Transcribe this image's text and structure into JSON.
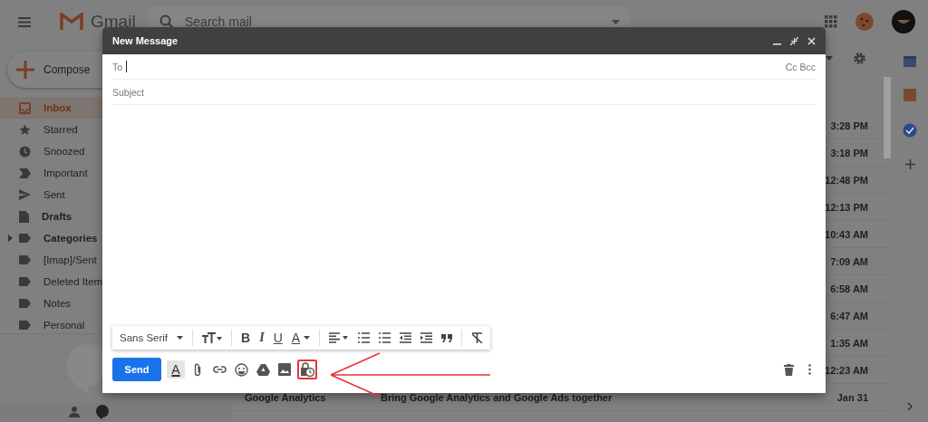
{
  "app": {
    "name": "Gmail",
    "search": {
      "placeholder": "Search mail"
    }
  },
  "compose_button": {
    "label": "Compose"
  },
  "sidebar": {
    "items": [
      {
        "label": "Inbox",
        "selected": true,
        "bold": true
      },
      {
        "label": "Starred",
        "selected": false,
        "bold": false
      },
      {
        "label": "Snoozed",
        "selected": false,
        "bold": false
      },
      {
        "label": "Important",
        "selected": false,
        "bold": false
      },
      {
        "label": "Sent",
        "selected": false,
        "bold": false
      },
      {
        "label": "Drafts",
        "selected": false,
        "bold": true
      },
      {
        "label": "Categories",
        "selected": false,
        "bold": true,
        "expanded": false
      },
      {
        "label": "[Imap]/Sent",
        "selected": false,
        "bold": false
      },
      {
        "label": "Deleted Item",
        "selected": false,
        "bold": false
      },
      {
        "label": "Notes",
        "selected": false,
        "bold": false
      },
      {
        "label": "Personal",
        "selected": false,
        "bold": false
      }
    ]
  },
  "message_list": {
    "rows": [
      {
        "time": "3:28 PM"
      },
      {
        "time": "3:18 PM"
      },
      {
        "time": "12:48 PM"
      },
      {
        "time": "12:13 PM"
      },
      {
        "time": "10:43 AM"
      },
      {
        "time": "7:09 AM"
      },
      {
        "time": "6:58 AM"
      },
      {
        "time": "6:47 AM"
      },
      {
        "time": "1:35 AM"
      },
      {
        "time": "12:23 AM"
      },
      {
        "sender": "Google Analytics",
        "subject": "Bring Google Analytics and Google Ads together",
        "time": "Jan 31"
      }
    ]
  },
  "compose": {
    "title": "New Message",
    "to_label": "To",
    "cc_bcc": "Cc Bcc",
    "subject_placeholder": "Subject",
    "format_toolbar": [
      {
        "kind": "font",
        "label": "Sans Serif"
      },
      {
        "kind": "size"
      },
      {
        "kind": "bold",
        "glyph": "B"
      },
      {
        "kind": "italic",
        "glyph": "I"
      },
      {
        "kind": "underline",
        "glyph": "U"
      },
      {
        "kind": "color",
        "glyph": "A"
      },
      {
        "kind": "align"
      },
      {
        "kind": "numbered"
      },
      {
        "kind": "bulleted"
      },
      {
        "kind": "outdent"
      },
      {
        "kind": "indent"
      },
      {
        "kind": "quote"
      },
      {
        "kind": "clear"
      }
    ],
    "send_label": "Send",
    "actions": [
      {
        "kind": "formatting",
        "glyph": "A",
        "selected": true,
        "highlighted": false
      },
      {
        "kind": "attach",
        "selected": false,
        "highlighted": false
      },
      {
        "kind": "link",
        "selected": false,
        "highlighted": false
      },
      {
        "kind": "emoji",
        "selected": false,
        "highlighted": false
      },
      {
        "kind": "drive",
        "selected": false,
        "highlighted": false
      },
      {
        "kind": "photo",
        "selected": false,
        "highlighted": false
      },
      {
        "kind": "confidential",
        "selected": false,
        "highlighted": true
      }
    ]
  }
}
